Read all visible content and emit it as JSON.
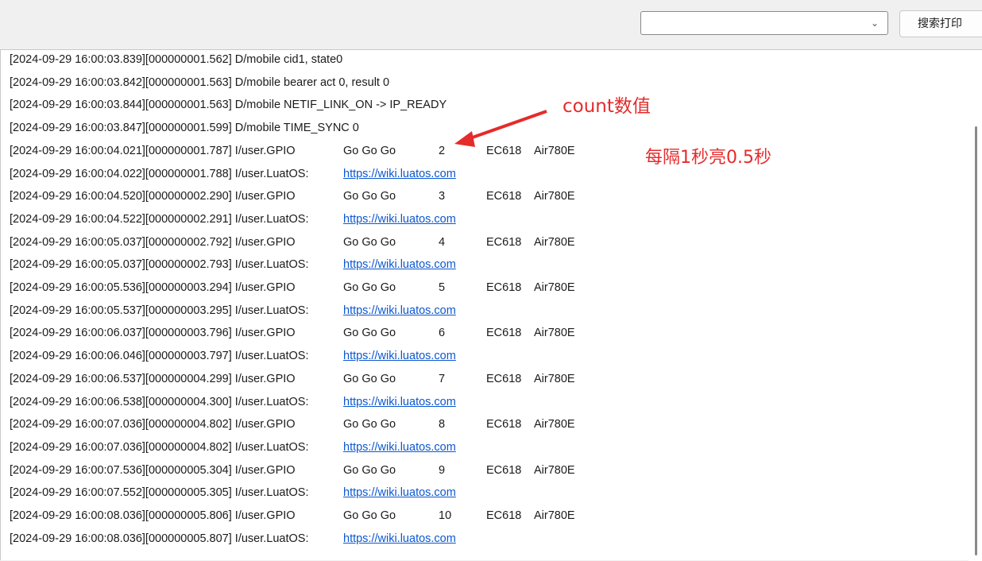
{
  "toolbar": {
    "combo_value": "",
    "search_print_label": "搜索打印"
  },
  "log": [
    {
      "prefix": "[2024-09-29 16:00:03.839][000000001.562] D/mobile cid1, state0"
    },
    {
      "prefix": "[2024-09-29 16:00:03.842][000000001.563] D/mobile bearer act 0, result 0"
    },
    {
      "prefix": "[2024-09-29 16:00:03.844][000000001.563] D/mobile NETIF_LINK_ON -> IP_READY"
    },
    {
      "prefix": "[2024-09-29 16:00:03.847][000000001.599] D/mobile TIME_SYNC 0"
    },
    {
      "prefix": "[2024-09-29 16:00:04.021][000000001.787] I/user.GPIO",
      "tag": "Go Go Go",
      "count": "2",
      "chip": "EC618",
      "module": "Air780E"
    },
    {
      "prefix": "[2024-09-29 16:00:04.022][000000001.788] I/user.LuatOS:",
      "link": "https://wiki.luatos.com"
    },
    {
      "prefix": "[2024-09-29 16:00:04.520][000000002.290] I/user.GPIO",
      "tag": "Go Go Go",
      "count": "3",
      "chip": "EC618",
      "module": "Air780E"
    },
    {
      "prefix": "[2024-09-29 16:00:04.522][000000002.291] I/user.LuatOS:",
      "link": "https://wiki.luatos.com"
    },
    {
      "prefix": "[2024-09-29 16:00:05.037][000000002.792] I/user.GPIO",
      "tag": "Go Go Go",
      "count": "4",
      "chip": "EC618",
      "module": "Air780E"
    },
    {
      "prefix": "[2024-09-29 16:00:05.037][000000002.793] I/user.LuatOS:",
      "link": "https://wiki.luatos.com"
    },
    {
      "prefix": "[2024-09-29 16:00:05.536][000000003.294] I/user.GPIO",
      "tag": "Go Go Go",
      "count": "5",
      "chip": "EC618",
      "module": "Air780E"
    },
    {
      "prefix": "[2024-09-29 16:00:05.537][000000003.295] I/user.LuatOS:",
      "link": "https://wiki.luatos.com"
    },
    {
      "prefix": "[2024-09-29 16:00:06.037][000000003.796] I/user.GPIO",
      "tag": "Go Go Go",
      "count": "6",
      "chip": "EC618",
      "module": "Air780E"
    },
    {
      "prefix": "[2024-09-29 16:00:06.046][000000003.797] I/user.LuatOS:",
      "link": "https://wiki.luatos.com"
    },
    {
      "prefix": "[2024-09-29 16:00:06.537][000000004.299] I/user.GPIO",
      "tag": "Go Go Go",
      "count": "7",
      "chip": "EC618",
      "module": "Air780E"
    },
    {
      "prefix": "[2024-09-29 16:00:06.538][000000004.300] I/user.LuatOS:",
      "link": "https://wiki.luatos.com"
    },
    {
      "prefix": "[2024-09-29 16:00:07.036][000000004.802] I/user.GPIO",
      "tag": "Go Go Go",
      "count": "8",
      "chip": "EC618",
      "module": "Air780E"
    },
    {
      "prefix": "[2024-09-29 16:00:07.036][000000004.802] I/user.LuatOS:",
      "link": "https://wiki.luatos.com"
    },
    {
      "prefix": "[2024-09-29 16:00:07.536][000000005.304] I/user.GPIO",
      "tag": "Go Go Go",
      "count": "9",
      "chip": "EC618",
      "module": "Air780E"
    },
    {
      "prefix": "[2024-09-29 16:00:07.552][000000005.305] I/user.LuatOS:",
      "link": "https://wiki.luatos.com"
    },
    {
      "prefix": "[2024-09-29 16:00:08.036][000000005.806] I/user.GPIO",
      "tag": "Go Go Go",
      "count": "10",
      "chip": "EC618",
      "module": "Air780E"
    },
    {
      "prefix": "[2024-09-29 16:00:08.036][000000005.807] I/user.LuatOS:",
      "link": "https://wiki.luatos.com"
    }
  ],
  "annotations": {
    "count_label": "count数值",
    "blink_label": "每隔1秒亮0.5秒",
    "color": "#e52b2b"
  },
  "colors": {
    "link": "#0b57d0",
    "text": "#1a1a1a"
  }
}
